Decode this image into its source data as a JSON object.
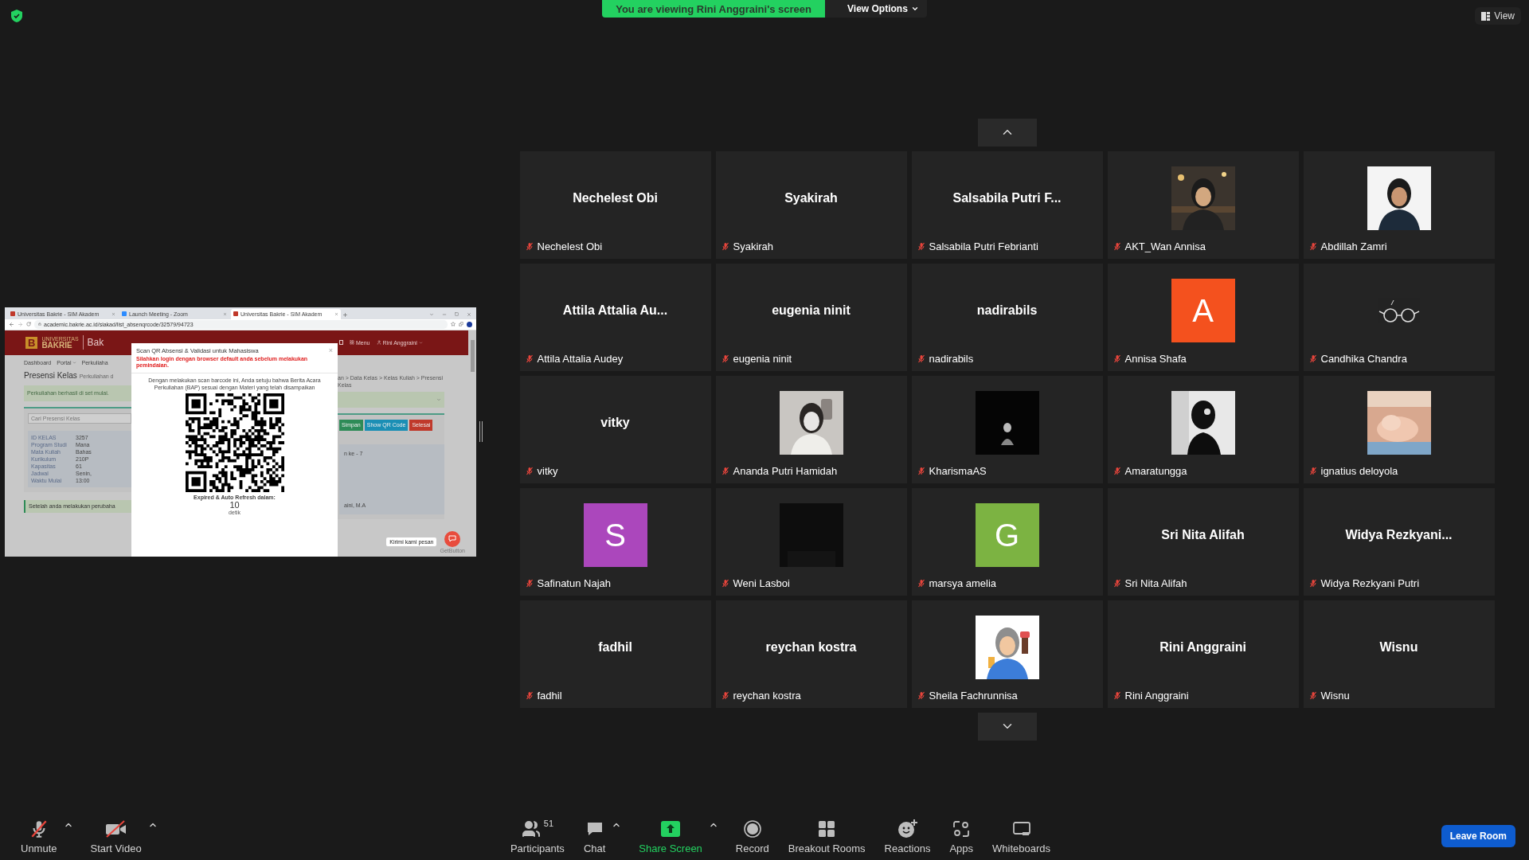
{
  "top_bar": {
    "banner": "You are viewing Rini Anggraini's screen",
    "view_options": "View Options",
    "view_button": "View"
  },
  "shared_screen": {
    "tabs": [
      {
        "title": "Universitas Bakrie - SIM Akadem",
        "selected": false
      },
      {
        "title": "Launch Meeting - Zoom",
        "selected": false
      },
      {
        "title": "Universitas Bakrie - SIM Akadem",
        "selected": true
      }
    ],
    "url": "academic.bakrie.ac.id/siakad/list_absenqrcode/32579/94723",
    "site": {
      "logo_mark": "B",
      "logo_top": "UNIVERSITAS",
      "logo_bottom": "BAKRIE",
      "title": "Bak",
      "menu": "Menu",
      "user": "Rini Anggraini"
    },
    "nav": [
      "Dashboard",
      "Portal",
      "Perkuliaha"
    ],
    "page_title": "Presensi Kelas",
    "page_subtitle": "Perkuliahan d",
    "breadcrumb": "an > Data Kelas > Kelas Kuliah > Presensi Kelas",
    "alert": "Perkuliahan berhasil di set mulai.",
    "search": {
      "placeholder": "Cari Presensi Kelas"
    },
    "buttons": [
      "Simpan",
      "Show QR Code",
      "Selesai"
    ],
    "info": [
      {
        "label": "ID KELAS",
        "value": "3257"
      },
      {
        "label": "Program Studi",
        "value": "Mana"
      },
      {
        "label": "Mata Kuliah",
        "value": "Bahas"
      },
      {
        "label": "Kurikulum",
        "value": "210P"
      },
      {
        "label": "Kapasitas",
        "value": "61"
      },
      {
        "label": "Jadwal",
        "value": "Senin,"
      },
      {
        "label": "Waktu Mulai",
        "value": "13:00"
      }
    ],
    "info_right": [
      "n ke - 7",
      "aini, M.A"
    ],
    "note": "Setelah anda melakukan perubaha",
    "chat_tooltip": "Kirimi kami pesan",
    "chat_brand": "GetButton",
    "modal": {
      "title": "Scan QR Absensi & Validasi untuk Mahasiswa",
      "close": "×",
      "warning": "Silahkan login dengan browser default anda sebelum melakukan pemindaian.",
      "body": "Dengan melakukan scan barcode ini, Anda setuju bahwa Berita Acara Perkuliahan (BAP) sesuai dengan Materi yang telah disampaikan",
      "countdown_label": "Expired & Auto Refresh dalam:",
      "countdown": "10",
      "unit": "detik"
    }
  },
  "gallery": {
    "tiles": [
      {
        "kind": "name",
        "display": "Nechelest Obi",
        "name": "Nechelest Obi",
        "muted": true
      },
      {
        "kind": "name",
        "display": "Syakirah",
        "name": "Syakirah",
        "muted": true
      },
      {
        "kind": "name",
        "display": "Salsabila Putri F...",
        "name": "Salsabila Putri Febrianti",
        "muted": true
      },
      {
        "kind": "picture",
        "name": "AKT_Wan Annisa",
        "muted": true
      },
      {
        "kind": "picture",
        "name": "Abdillah Zamri",
        "muted": true
      },
      {
        "kind": "name",
        "display": "Attila Attalia Au...",
        "name": "Attila Attalia Audey",
        "muted": true
      },
      {
        "kind": "name",
        "display": "eugenia ninit",
        "name": "eugenia ninit",
        "muted": true
      },
      {
        "kind": "name",
        "display": "nadirabils",
        "name": "nadirabils",
        "muted": true
      },
      {
        "kind": "avatar",
        "letter": "A",
        "color": "#f4511e",
        "name": "Annisa Shafa",
        "muted": true
      },
      {
        "kind": "picture",
        "name": "Candhika Chandra",
        "muted": true
      },
      {
        "kind": "name",
        "display": "vitky",
        "name": "vitky",
        "muted": true
      },
      {
        "kind": "picture",
        "name": "Ananda Putri Hamidah",
        "muted": true
      },
      {
        "kind": "picture",
        "name": "KharismaAS",
        "muted": true
      },
      {
        "kind": "picture",
        "name": "Amaratungga",
        "muted": true
      },
      {
        "kind": "picture",
        "name": "ignatius deloyola",
        "muted": true
      },
      {
        "kind": "avatar",
        "letter": "S",
        "color": "#ab47bc",
        "name": "Safinatun Najah",
        "muted": true
      },
      {
        "kind": "picture",
        "name": "Weni Lasboi",
        "muted": true
      },
      {
        "kind": "avatar",
        "letter": "G",
        "color": "#7cb342",
        "name": "marsya amelia",
        "muted": true
      },
      {
        "kind": "name",
        "display": "Sri Nita Alifah",
        "name": "Sri Nita Alifah",
        "muted": true
      },
      {
        "kind": "name",
        "display": "Widya  Rezkyani...",
        "name": "Widya Rezkyani Putri",
        "muted": true
      },
      {
        "kind": "name",
        "display": "fadhil",
        "name": "fadhil",
        "muted": true
      },
      {
        "kind": "name",
        "display": "reychan kostra",
        "name": "reychan kostra",
        "muted": true
      },
      {
        "kind": "picture",
        "name": "Sheila Fachrunnisa",
        "muted": true
      },
      {
        "kind": "name",
        "display": "Rini Anggraini",
        "name": "Rini Anggraini",
        "muted": true
      },
      {
        "kind": "name",
        "display": "Wisnu",
        "name": "Wisnu",
        "muted": true
      }
    ]
  },
  "toolbar": {
    "left": [
      {
        "kind": "mic",
        "label": "Unmute",
        "caret": true
      },
      {
        "kind": "video",
        "label": "Start Video",
        "caret": true
      }
    ],
    "center": [
      {
        "kind": "participants",
        "label": "Participants",
        "count": "51",
        "caret": false,
        "active": false
      },
      {
        "kind": "chat",
        "label": "Chat",
        "caret": true,
        "active": false
      },
      {
        "kind": "share",
        "label": "Share Screen",
        "caret": true,
        "active": true
      },
      {
        "kind": "record",
        "label": "Record",
        "caret": false,
        "active": false
      },
      {
        "kind": "breakout",
        "label": "Breakout Rooms",
        "caret": false,
        "active": false
      },
      {
        "kind": "reactions",
        "label": "Reactions",
        "caret": false,
        "active": false
      },
      {
        "kind": "apps",
        "label": "Apps",
        "caret": false,
        "active": false
      },
      {
        "kind": "whiteboard",
        "label": "Whiteboards",
        "caret": false,
        "active": false
      }
    ],
    "leave": "Leave Room"
  }
}
